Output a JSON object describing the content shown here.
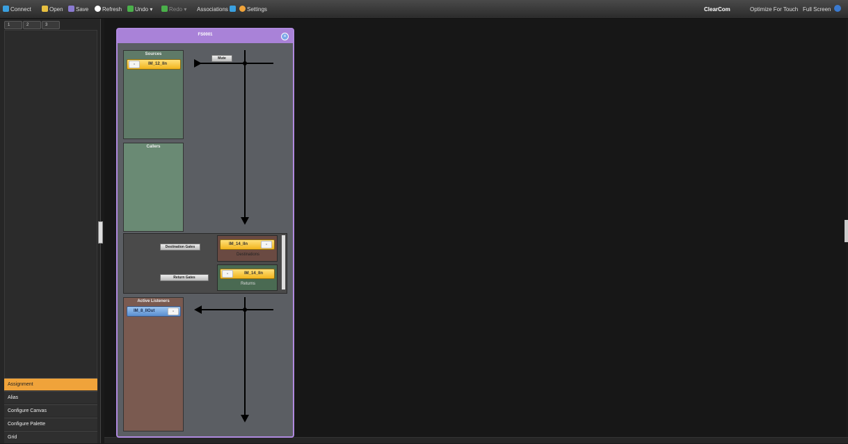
{
  "toolbar": {
    "connect": "Connect",
    "open": "Open",
    "save": "Save",
    "refresh": "Refresh",
    "undo": "Undo",
    "redo": "Redo",
    "associations": "Associations",
    "settings": "Settings",
    "brand": "ClearCom",
    "optimize_touch": "Optimize For Touch",
    "full_screen": "Full Screen"
  },
  "sidebar": {
    "tabs": [
      "1",
      "2",
      "3"
    ],
    "nav": [
      {
        "label": "Assignment",
        "active": true
      },
      {
        "label": "Alias",
        "active": false
      },
      {
        "label": "Configure Canvas",
        "active": false
      },
      {
        "label": "Configure Palette",
        "active": false
      },
      {
        "label": "Grid",
        "active": false
      }
    ]
  },
  "panel": {
    "title": "FS0001",
    "sources_title": "Sources",
    "sources_chip": "IM_12_IIn",
    "mute_label": "Mute",
    "callers_title": "Callers",
    "destination_gain_label": "Destination Gates",
    "destination_chip": "IM_14_IIn",
    "destinations_caption": "Destinations",
    "return_gain_label": "Return Gates",
    "return_chip": "IM_14_IIn",
    "returns_caption": "Returns",
    "active_listeners_title": "Active Listeners",
    "listener_chip": "IM_8_IIOut"
  },
  "colors": {
    "accent": "#f0a33a",
    "panel_border": "#b08ae0",
    "chip_yellow": "#f2b41c",
    "chip_blue": "#5b8fd0",
    "sources_bg": "#5f7a68",
    "callers_bg": "#6a8a74",
    "listeners_bg": "#7a5a50"
  }
}
